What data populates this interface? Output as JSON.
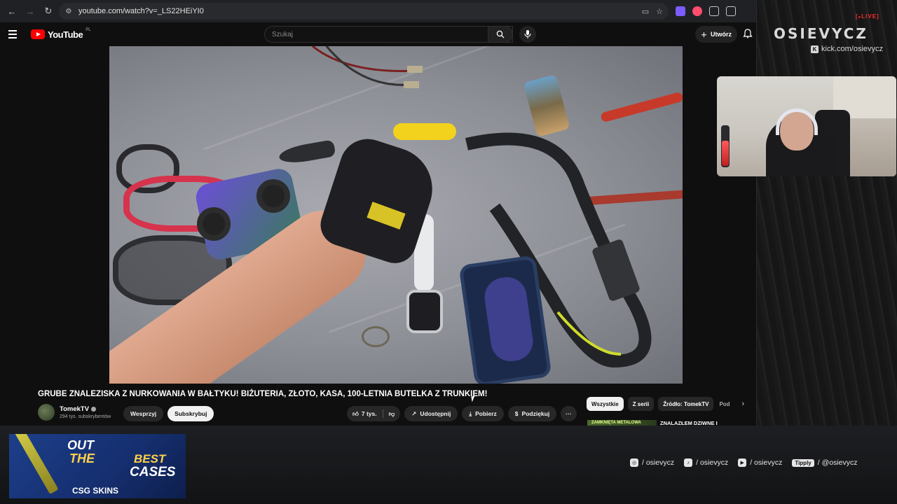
{
  "browser": {
    "url": "youtube.com/watch?v=_LS22HEiYI0",
    "nav": {
      "back": "←",
      "forward": "→",
      "reload": "↻"
    }
  },
  "youtube": {
    "logo_text": "YouTube",
    "region": "PL",
    "search_placeholder": "Szukaj",
    "create_label": "Utwórz"
  },
  "video": {
    "title": "GRUBE ZNALEZISKA Z NURKOWANIA W BAŁTYKU! BIŻUTERIA, ZŁOTO, KASA, 100-LETNIA BUTELKA Z TRUNKIEM!",
    "channel_name": "TomekTV",
    "subscribers": "294 tys. subskrybentów",
    "support_label": "Wesprzyj",
    "subscribe_label": "Subskrybuj",
    "likes": "7 tys.",
    "share_label": "Udostępnij",
    "download_label": "Pobierz",
    "thanks_label": "Podziękuj",
    "more_label": "···"
  },
  "chips": {
    "items": [
      "Wszystkie",
      "Z serii",
      "Źródło: TomekTV",
      "Pod"
    ],
    "active_index": 0
  },
  "recommendation": {
    "thumb_text": "ZAMKNIĘTA METALOWA",
    "title": "ZNALAZŁEM DZIWNE I"
  },
  "overlay": {
    "live_label": "LIVE",
    "brand": "OSIEVYCZ",
    "kick_url": "kick.com/osievycz",
    "sponsor": {
      "line1": "OUT",
      "line2": "THE",
      "line3": "BEST",
      "line4": "CASES",
      "brand": "CSG SKINS"
    },
    "socials": [
      {
        "icon": "instagram-icon",
        "glyph": "◎",
        "handle": "/ osievycz"
      },
      {
        "icon": "tiktok-icon",
        "glyph": "♪",
        "handle": "/ osievycz"
      },
      {
        "icon": "youtube-icon",
        "glyph": "▶",
        "handle": "/ osievycz"
      },
      {
        "icon": "tipply-icon",
        "glyph": "Tipply",
        "handle": "/ @osievycz"
      }
    ]
  },
  "colors": {
    "youtube_red": "#ff0000",
    "live_red": "#ff2e2e",
    "page_bg": "#0f0f0f",
    "pill_bg": "#272727"
  }
}
